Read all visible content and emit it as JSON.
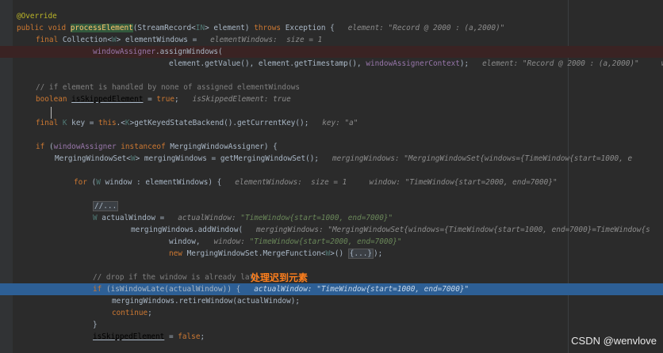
{
  "lines": [
    {
      "row": 1,
      "indent": 0,
      "highlight": "",
      "tokens": [
        {
          "t": "@Override",
          "c": "ann"
        }
      ]
    },
    {
      "row": 2,
      "indent": 0,
      "highlight": "",
      "tokens": [
        {
          "t": "public void ",
          "c": "kw"
        },
        {
          "t": "processElement",
          "c": "fnhl"
        },
        {
          "t": "(StreamRecord<",
          "c": "pl"
        },
        {
          "t": "IN",
          "c": "tp"
        },
        {
          "t": "> element) ",
          "c": "pl"
        },
        {
          "t": "throws ",
          "c": "kw"
        },
        {
          "t": "Exception {   ",
          "c": "pl"
        },
        {
          "t": "element: ",
          "c": "hint"
        },
        {
          "t": "\"Record @ 2000 : (a,2000)\"",
          "c": "hint"
        }
      ]
    },
    {
      "row": 3,
      "indent": 1,
      "highlight": "",
      "tokens": [
        {
          "t": "final ",
          "c": "kw"
        },
        {
          "t": "Collection<",
          "c": "pl"
        },
        {
          "t": "W",
          "c": "tp"
        },
        {
          "t": "> elementWindows =   ",
          "c": "pl"
        },
        {
          "t": "elementWindows:  size = 1",
          "c": "hint"
        }
      ]
    },
    {
      "row": 4,
      "indent": 4,
      "highlight": "red",
      "tokens": [
        {
          "t": "windowAssigner",
          "c": "fld"
        },
        {
          "t": ".assignWindows(",
          "c": "pl"
        }
      ]
    },
    {
      "row": 5,
      "indent": 8,
      "highlight": "",
      "tokens": [
        {
          "t": "element.getValue(), element.getTimestamp(), ",
          "c": "pl"
        },
        {
          "t": "windowAssignerContext",
          "c": "fld"
        },
        {
          "t": ");   ",
          "c": "pl"
        },
        {
          "t": "element: \"Record @ 2000 : (a,2000)\"     window",
          "c": "hint"
        }
      ]
    },
    {
      "row": 6,
      "indent": 0,
      "highlight": "",
      "tokens": []
    },
    {
      "row": 7,
      "indent": 1,
      "highlight": "",
      "tokens": [
        {
          "t": "// if element is handled by none of assigned elementWindows",
          "c": "cm"
        }
      ]
    },
    {
      "row": 8,
      "indent": 1,
      "highlight": "",
      "tokens": [
        {
          "t": "boolean ",
          "c": "kw"
        },
        {
          "t": "isSkippedElement",
          "c": "und"
        },
        {
          "t": " = ",
          "c": "pl"
        },
        {
          "t": "true",
          "c": "kw"
        },
        {
          "t": ";   ",
          "c": "pl"
        },
        {
          "t": "isSkippedElement: true",
          "c": "hint"
        }
      ]
    },
    {
      "row": 9,
      "indent": 0,
      "highlight": "",
      "tokens": []
    },
    {
      "row": 10,
      "indent": 1,
      "highlight": "",
      "tokens": [
        {
          "t": "final ",
          "c": "kw"
        },
        {
          "t": "K",
          "c": "tp"
        },
        {
          "t": " key = ",
          "c": "pl"
        },
        {
          "t": "this",
          "c": "kw"
        },
        {
          "t": ".<",
          "c": "pl"
        },
        {
          "t": "K",
          "c": "tp"
        },
        {
          "t": ">getKeyedStateBackend().getCurrentKey();   ",
          "c": "pl"
        },
        {
          "t": "key: \"a\"",
          "c": "hint"
        }
      ]
    },
    {
      "row": 11,
      "indent": 0,
      "highlight": "",
      "tokens": []
    },
    {
      "row": 12,
      "indent": 1,
      "highlight": "",
      "tokens": [
        {
          "t": "if ",
          "c": "kw"
        },
        {
          "t": "(",
          "c": "pl"
        },
        {
          "t": "windowAssigner ",
          "c": "fld"
        },
        {
          "t": "instanceof ",
          "c": "kw"
        },
        {
          "t": "MergingWindowAssigner) {",
          "c": "pl"
        }
      ]
    },
    {
      "row": 13,
      "indent": 2,
      "highlight": "",
      "tokens": [
        {
          "t": "MergingWindowSet<",
          "c": "pl"
        },
        {
          "t": "W",
          "c": "tp"
        },
        {
          "t": "> mergingWindows = getMergingWindowSet();   ",
          "c": "pl"
        },
        {
          "t": "mergingWindows: \"MergingWindowSet{windows={TimeWindow{start=1000, e",
          "c": "hint"
        }
      ]
    },
    {
      "row": 14,
      "indent": 0,
      "highlight": "",
      "tokens": []
    },
    {
      "row": 15,
      "indent": 3,
      "highlight": "",
      "tokens": [
        {
          "t": "for ",
          "c": "kw"
        },
        {
          "t": "(",
          "c": "pl"
        },
        {
          "t": "W",
          "c": "tp"
        },
        {
          "t": " window : elementWindows) {   ",
          "c": "pl"
        },
        {
          "t": "elementWindows:  size = 1     window: \"TimeWindow{start=2000, end=7000}\"",
          "c": "hint"
        }
      ]
    },
    {
      "row": 16,
      "indent": 0,
      "highlight": "",
      "tokens": []
    },
    {
      "row": 17,
      "indent": 4,
      "highlight": "",
      "tokens": [
        {
          "t": "//...",
          "c": "fold"
        }
      ]
    },
    {
      "row": 18,
      "indent": 4,
      "highlight": "",
      "tokens": [
        {
          "t": "W",
          "c": "tp"
        },
        {
          "t": " actualWindow =   ",
          "c": "pl"
        },
        {
          "t": "actualWindow: ",
          "c": "hint"
        },
        {
          "t": "\"TimeWindow{start=1000, end=7000}\"",
          "c": "hintv"
        }
      ]
    },
    {
      "row": 19,
      "indent": 6,
      "highlight": "",
      "tokens": [
        {
          "t": "mergingWindows.addWindow(   ",
          "c": "pl"
        },
        {
          "t": "mergingWindows: \"MergingWindowSet{windows={TimeWindow{start=1000, end=7000}=TimeWindow{s",
          "c": "hint"
        }
      ]
    },
    {
      "row": 20,
      "indent": 8,
      "highlight": "",
      "tokens": [
        {
          "t": "window,   ",
          "c": "pl"
        },
        {
          "t": "window: ",
          "c": "hint"
        },
        {
          "t": "\"TimeWindow{start=2000, end=7000}\"",
          "c": "hintv"
        }
      ]
    },
    {
      "row": 21,
      "indent": 8,
      "highlight": "",
      "tokens": [
        {
          "t": "new ",
          "c": "kw"
        },
        {
          "t": "MergingWindowSet.MergeFunction<",
          "c": "pl"
        },
        {
          "t": "W",
          "c": "tp"
        },
        {
          "t": ">() ",
          "c": "pl"
        },
        {
          "t": "{...}",
          "c": "fold"
        },
        {
          "t": ");",
          "c": "pl"
        }
      ]
    },
    {
      "row": 22,
      "indent": 0,
      "highlight": "",
      "tokens": []
    },
    {
      "row": 23,
      "indent": 4,
      "highlight": "",
      "tokens": [
        {
          "t": "// drop if the window is already late",
          "c": "cm"
        }
      ]
    },
    {
      "row": 24,
      "indent": 4,
      "highlight": "blue",
      "tokens": [
        {
          "t": "if ",
          "c": "kw"
        },
        {
          "t": "(isWindowLate(actualWindow)) {   ",
          "c": "pl"
        },
        {
          "t": "actualWindow: ",
          "c": "hint"
        },
        {
          "t": "\"TimeWindow{start=1000, end=7000}\"",
          "c": "hintv"
        }
      ]
    },
    {
      "row": 25,
      "indent": 5,
      "highlight": "",
      "tokens": [
        {
          "t": "mergingWindows.retireWindow(actualWindow);",
          "c": "pl"
        }
      ]
    },
    {
      "row": 26,
      "indent": 5,
      "highlight": "",
      "tokens": [
        {
          "t": "continue",
          "c": "kw"
        },
        {
          "t": ";",
          "c": "pl"
        }
      ]
    },
    {
      "row": 27,
      "indent": 4,
      "highlight": "",
      "tokens": [
        {
          "t": "}",
          "c": "pl"
        }
      ]
    },
    {
      "row": 28,
      "indent": 4,
      "highlight": "",
      "tokens": [
        {
          "t": "isSkippedElement",
          "c": "und"
        },
        {
          "t": " = ",
          "c": "pl"
        },
        {
          "t": "false",
          "c": "kw"
        },
        {
          "t": ";",
          "c": "pl"
        }
      ]
    }
  ],
  "annotation": "处理迟到元素",
  "watermark": "CSDN @wenvlove"
}
